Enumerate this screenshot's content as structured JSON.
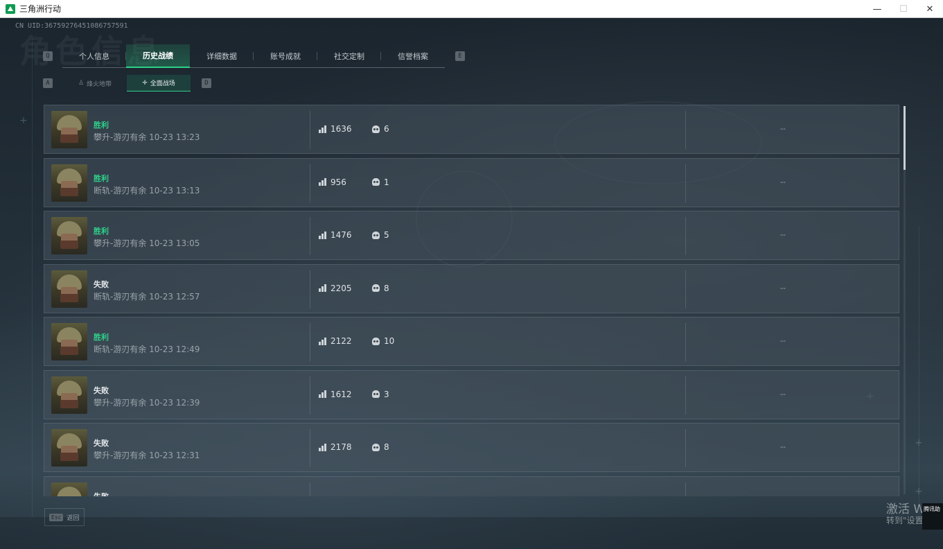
{
  "window": {
    "title": "三角洲行动",
    "controls": {
      "minimize": "—",
      "maximize": "☐",
      "close": "✕"
    }
  },
  "uid": "CN UID:36759276451086757591",
  "watermark": "角色信息",
  "tab_keys": {
    "left": "Q",
    "right": "E"
  },
  "tabs": [
    {
      "label": "个人信息"
    },
    {
      "label": "历史战绩"
    },
    {
      "label": "详细数据"
    },
    {
      "label": "账号成就"
    },
    {
      "label": "社交定制"
    },
    {
      "label": "信誉档案"
    }
  ],
  "active_tab": "历史战绩",
  "subtab_keys": {
    "left": "A",
    "right": "D"
  },
  "subtabs": [
    {
      "label": "烽火地带",
      "icon": "person-icon"
    },
    {
      "label": "全面战场",
      "icon": "crosshair-icon"
    }
  ],
  "active_subtab": "全面战场",
  "matches": [
    {
      "result": "胜利",
      "outcome": "win",
      "meta": "攀升-游刃有余 10-23 13:23",
      "score": "1636",
      "kills": "6",
      "extra": "--"
    },
    {
      "result": "胜利",
      "outcome": "win",
      "meta": "断轨-游刃有余 10-23 13:13",
      "score": "956",
      "kills": "1",
      "extra": "--"
    },
    {
      "result": "胜利",
      "outcome": "win",
      "meta": "攀升-游刃有余 10-23 13:05",
      "score": "1476",
      "kills": "5",
      "extra": "--"
    },
    {
      "result": "失败",
      "outcome": "loss",
      "meta": "断轨-游刃有余 10-23 12:57",
      "score": "2205",
      "kills": "8",
      "extra": "--"
    },
    {
      "result": "胜利",
      "outcome": "win",
      "meta": "断轨-游刃有余 10-23 12:49",
      "score": "2122",
      "kills": "10",
      "extra": "--"
    },
    {
      "result": "失败",
      "outcome": "loss",
      "meta": "攀升-游刃有余 10-23 12:39",
      "score": "1612",
      "kills": "3",
      "extra": "--"
    },
    {
      "result": "失败",
      "outcome": "loss",
      "meta": "攀升-游刃有余 10-23 12:31",
      "score": "2178",
      "kills": "8",
      "extra": "--"
    },
    {
      "result": "失败",
      "outcome": "loss",
      "meta": "",
      "score": "",
      "kills": "",
      "extra": ""
    }
  ],
  "footer": {
    "esc_key": "Esc",
    "back_label": "返回"
  },
  "os_overlay": {
    "activate": "激活 Wind",
    "activate_sub": "转到\"设置\"以",
    "badge": "腾讯助"
  },
  "colors": {
    "win": "#2fd18a",
    "loss": "#e3e7ea",
    "accent": "#2fd18a"
  }
}
